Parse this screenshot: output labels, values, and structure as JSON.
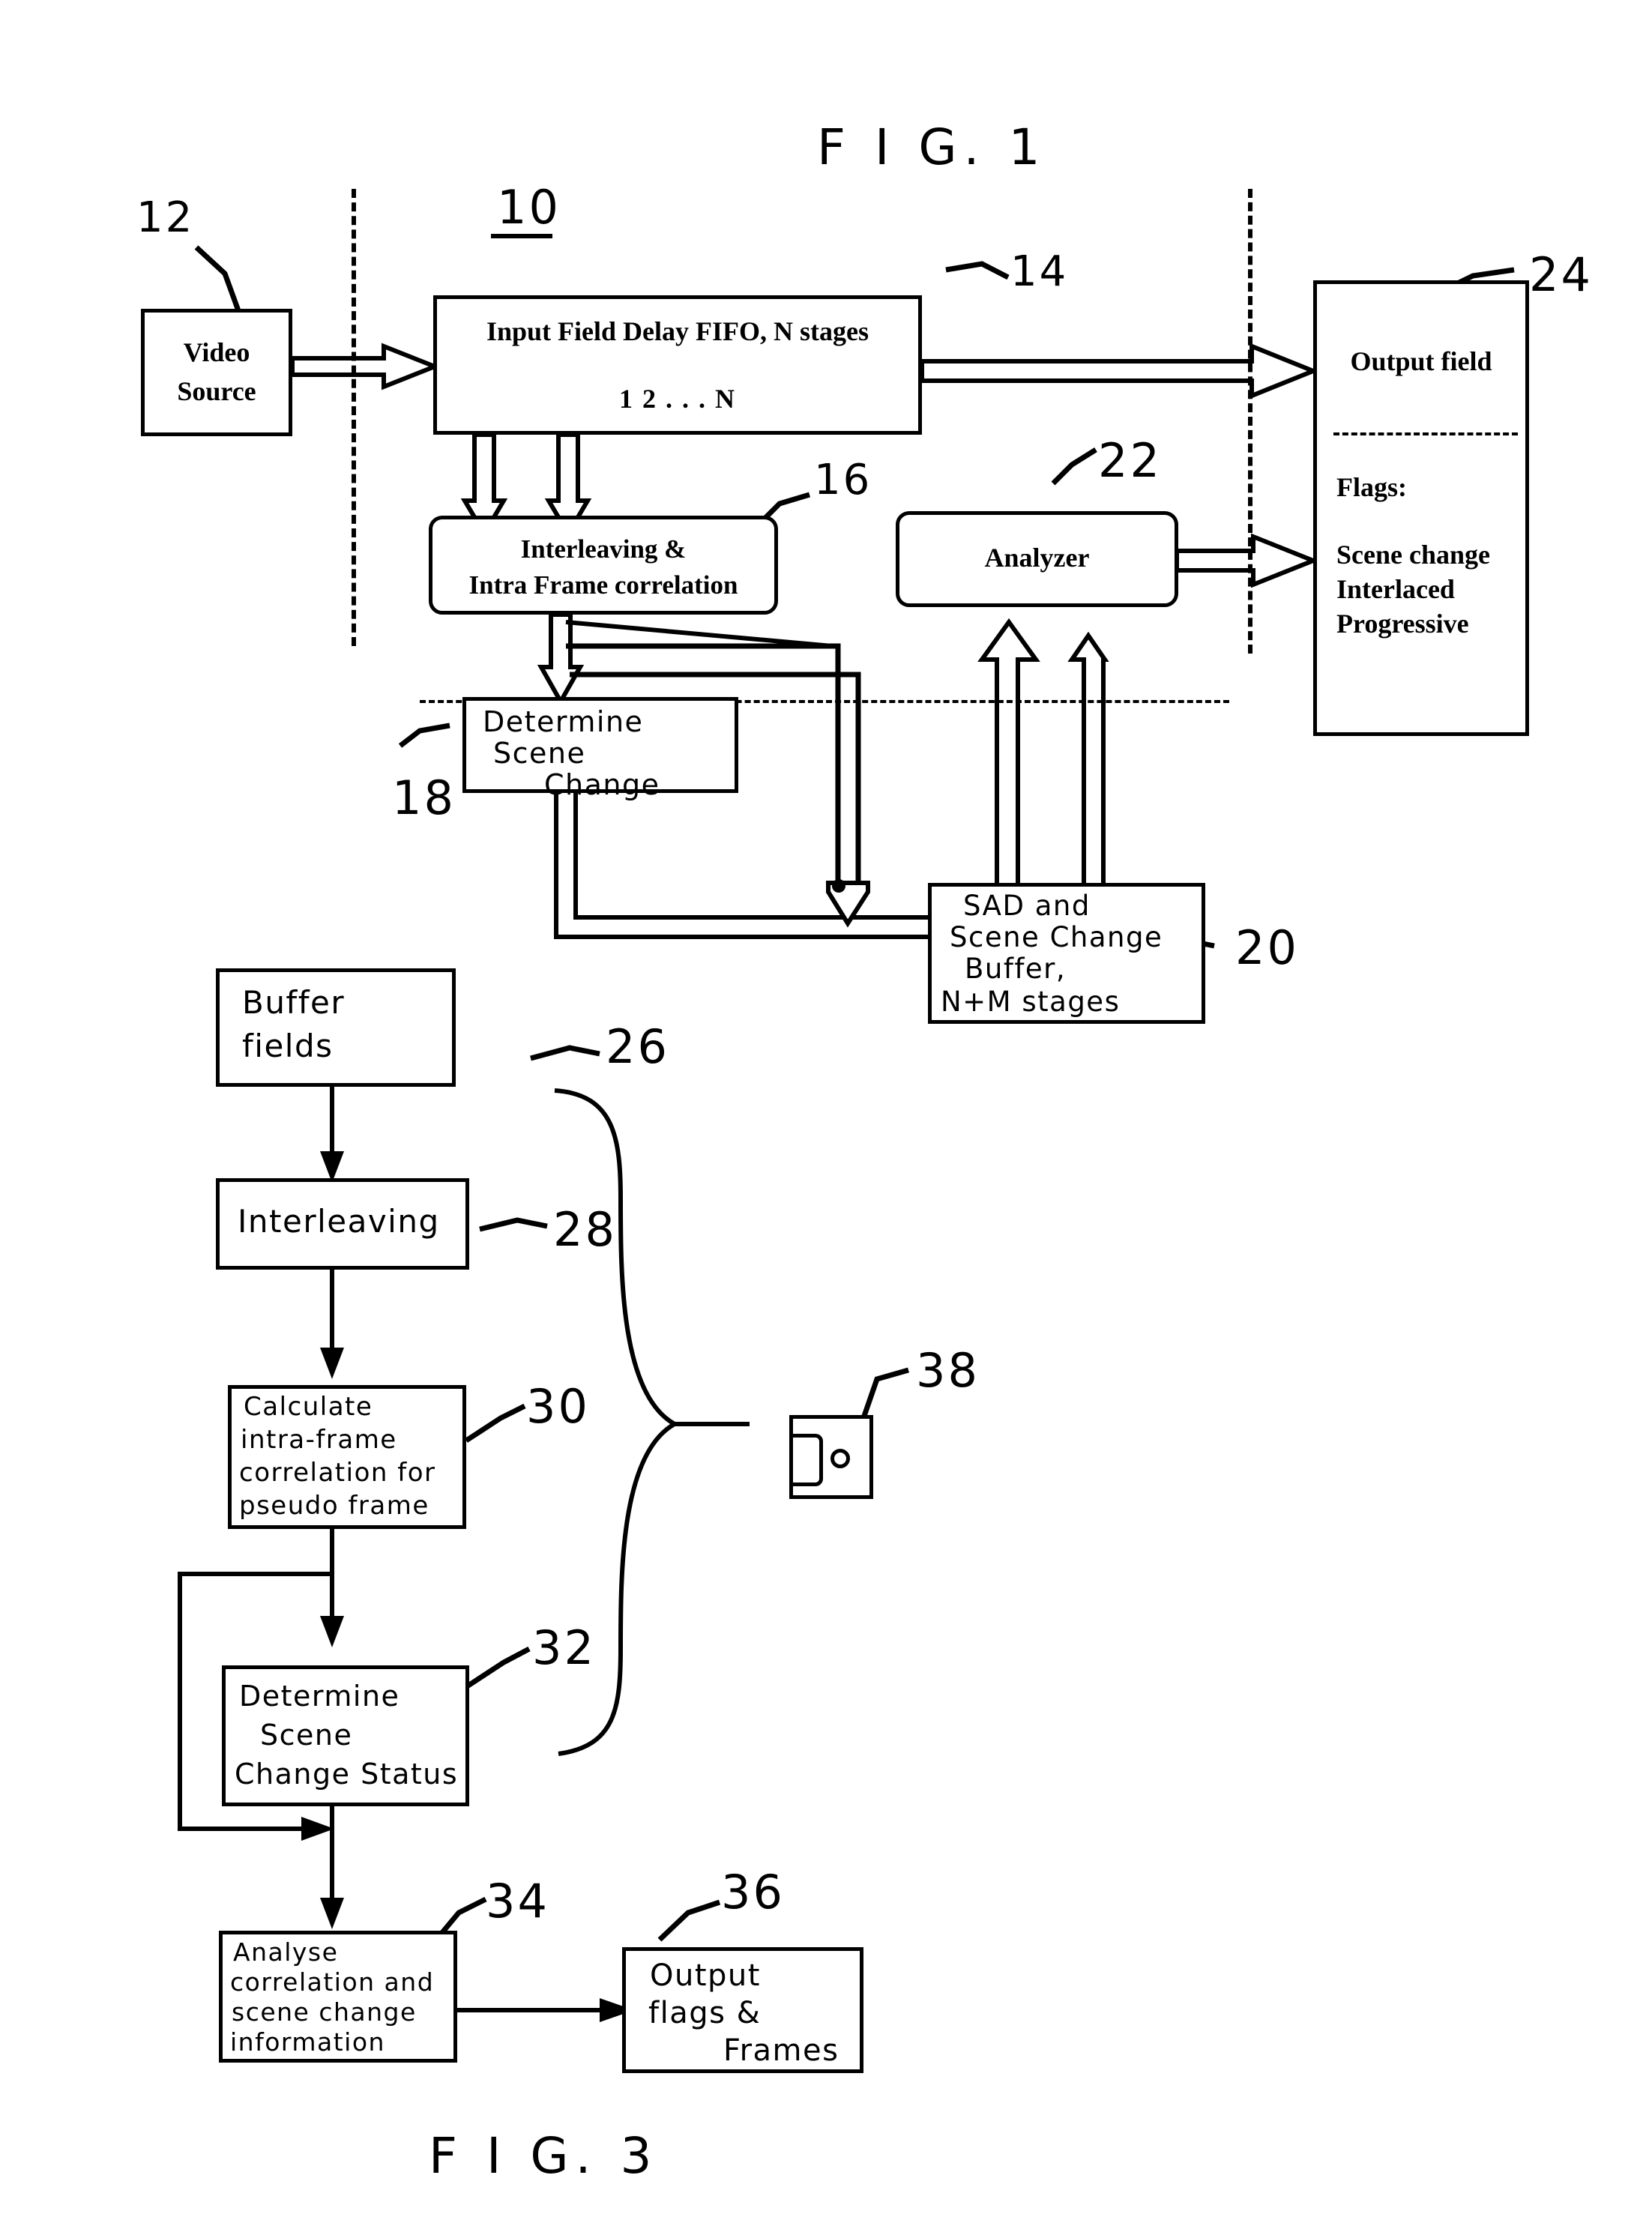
{
  "figure1": {
    "caption": "F I G. 1",
    "system_ref": "10",
    "blocks": {
      "video_source": {
        "ref": "12",
        "line1": "Video",
        "line2": "Source"
      },
      "fifo": {
        "ref": "14",
        "title": "Input Field Delay FIFO, N stages",
        "stages": "1     2    .     .     .     N"
      },
      "interleaving": {
        "ref": "16",
        "line1": "Interleaving &",
        "line2": "Intra Frame correlation"
      },
      "determine_scene_change": {
        "ref": "18",
        "line1": "Determine",
        "line2": "Scene",
        "line3": "Change"
      },
      "sad_buffer": {
        "ref": "20",
        "line1": "SAD and",
        "line2": "Scene Change",
        "line3": "Buffer,",
        "line4": "N+M stages"
      },
      "analyzer": {
        "ref": "22",
        "title": "Analyzer"
      },
      "output_field": {
        "ref": "24",
        "title": "Output field",
        "flags_label": "Flags:",
        "flags": [
          "Scene change",
          "Interlaced",
          "Progressive"
        ]
      }
    }
  },
  "figure3": {
    "caption": "F I G. 3",
    "blocks": {
      "buffer_fields": {
        "ref": "26",
        "line1": "Buffer",
        "line2": "fields"
      },
      "interleaving": {
        "ref": "28",
        "line1": "Interleaving"
      },
      "calculate_correlation": {
        "ref": "30",
        "line1": "Calculate",
        "line2": "intra-frame",
        "line3": "correlation for",
        "line4": "pseudo frame"
      },
      "determine_status": {
        "ref": "32",
        "line1": "Determine",
        "line2": "Scene",
        "line3": "Change Status"
      },
      "analyse": {
        "ref": "34",
        "line1": "Analyse",
        "line2": "correlation and",
        "line3": "scene change",
        "line4": "information"
      },
      "output_flags": {
        "ref": "36",
        "line1": "Output",
        "line2": "flags &",
        "line3": "Frames"
      },
      "media_symbol": {
        "ref": "38",
        "icon": "disk-icon"
      }
    }
  },
  "colors": {
    "ink": "#000000",
    "paper": "#ffffff"
  }
}
